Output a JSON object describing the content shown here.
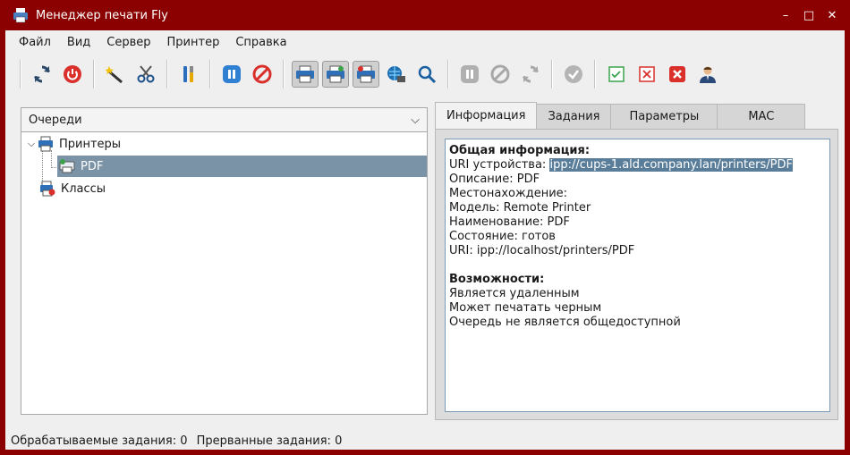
{
  "window": {
    "title": "Менеджер печати Fly",
    "controls": [
      "–",
      "□",
      "✕"
    ]
  },
  "menu": {
    "items": [
      "Файл",
      "Вид",
      "Сервер",
      "Принтер",
      "Справка"
    ]
  },
  "toolbar": {
    "icons": [
      "refresh-icon",
      "power-icon",
      "wand-icon",
      "scissors-icon",
      "tools-icon",
      "pause-icon",
      "stop-icon",
      "printer-icon",
      "printer-share-icon",
      "printer-default-icon",
      "network-printer-icon",
      "search-icon",
      "job-pause-icon",
      "job-cancel-icon",
      "job-restart-icon",
      "job-accept-icon",
      "check-box-icon",
      "cross-box-icon",
      "delete-icon",
      "user-icon"
    ]
  },
  "left": {
    "combo_label": "Очереди",
    "tree": {
      "printers": "Принтеры",
      "pdf": "PDF",
      "classes": "Классы"
    }
  },
  "tabs": [
    "Информация",
    "Задания",
    "Параметры",
    "MAC"
  ],
  "info": {
    "general_heading": "Общая информация:",
    "uri_device_label": "URI устройства: ",
    "uri_device_value": "ipp://cups-1.ald.company.lan/printers/PDF",
    "description": "Описание: PDF",
    "location": "Местонахождение:",
    "model": "Модель: Remote Printer",
    "name": "Наименование: PDF",
    "state": "Состояние: готов",
    "uri": "URI: ipp://localhost/printers/PDF",
    "caps_heading": "Возможности:",
    "cap1": "Является удаленным",
    "cap2": "Может печатать черным",
    "cap3": "Очередь не является общедоступной"
  },
  "status": {
    "processed": "Обрабатываемые задания: 0",
    "interrupted": "Прерванные задания: 0"
  },
  "colors": {
    "frame": "#8b0000",
    "selection": "#7b93a7",
    "highlight": "#5a7d9a"
  }
}
